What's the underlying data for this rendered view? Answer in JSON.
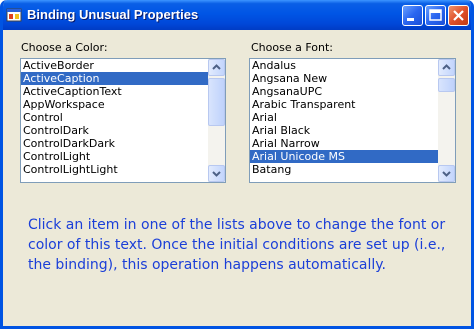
{
  "window": {
    "title": "Binding Unusual Properties"
  },
  "color_list": {
    "label": "Choose a Color:",
    "items": [
      "ActiveBorder",
      "ActiveCaption",
      "ActiveCaptionText",
      "AppWorkspace",
      "Control",
      "ControlDark",
      "ControlDarkDark",
      "ControlLight",
      "ControlLightLight"
    ],
    "selected": "ActiveCaption"
  },
  "font_list": {
    "label": "Choose a Font:",
    "items": [
      "Andalus",
      "Angsana New",
      "AngsanaUPC",
      "Arabic Transparent",
      "Arial",
      "Arial Black",
      "Arial Narrow",
      "Arial Unicode MS",
      "Batang"
    ],
    "selected": "Arial Unicode MS"
  },
  "info_text": "Click an item in one of the lists above to change the font or color of this text. Once the initial conditions are set up (i.e., the binding), this operation happens automatically."
}
